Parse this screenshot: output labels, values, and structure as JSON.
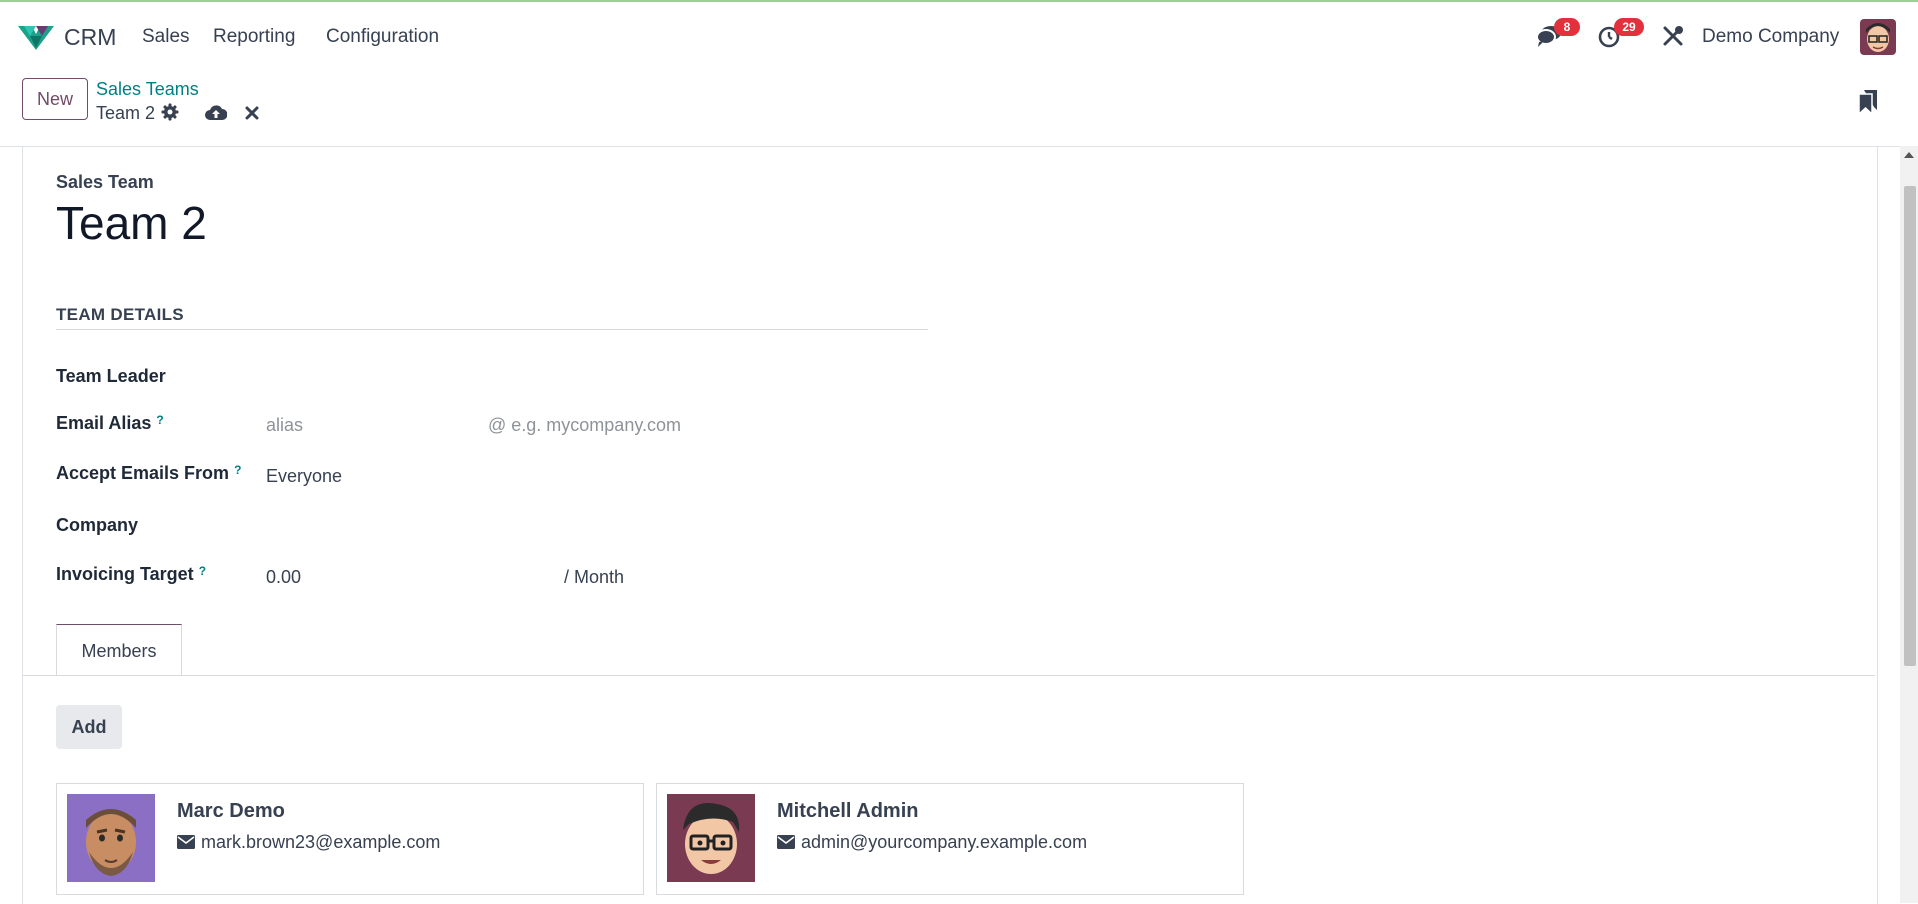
{
  "navbar": {
    "app_name": "CRM",
    "menu": [
      "Sales",
      "Reporting",
      "Configuration"
    ],
    "messages_badge": "8",
    "activities_badge": "29",
    "company": "Demo Company"
  },
  "control_panel": {
    "new_label": "New",
    "breadcrumb_parent": "Sales Teams",
    "breadcrumb_current": "Team 2"
  },
  "form": {
    "name_label": "Sales Team",
    "name": "Team 2",
    "section_title": "TEAM DETAILS",
    "fields": {
      "team_leader": {
        "label": "Team Leader",
        "value": ""
      },
      "email_alias": {
        "label": "Email Alias",
        "help": "?",
        "alias_placeholder": "alias",
        "domain_placeholder": "@ e.g. mycompany.com"
      },
      "accept_emails": {
        "label": "Accept Emails From",
        "help": "?",
        "value": "Everyone"
      },
      "company": {
        "label": "Company",
        "value": ""
      },
      "invoicing_target": {
        "label": "Invoicing Target",
        "help": "?",
        "value": "0.00",
        "suffix": "/ Month"
      }
    }
  },
  "tabs": [
    {
      "label": "Members",
      "active": true
    }
  ],
  "members": {
    "add_label": "Add",
    "items": [
      {
        "name": "Marc Demo",
        "email": "mark.brown23@example.com"
      },
      {
        "name": "Mitchell Admin",
        "email": "admin@yourcompany.example.com"
      }
    ]
  },
  "colors": {
    "brand": "#714b67",
    "link": "#017e84",
    "badge": "#e0313c"
  }
}
